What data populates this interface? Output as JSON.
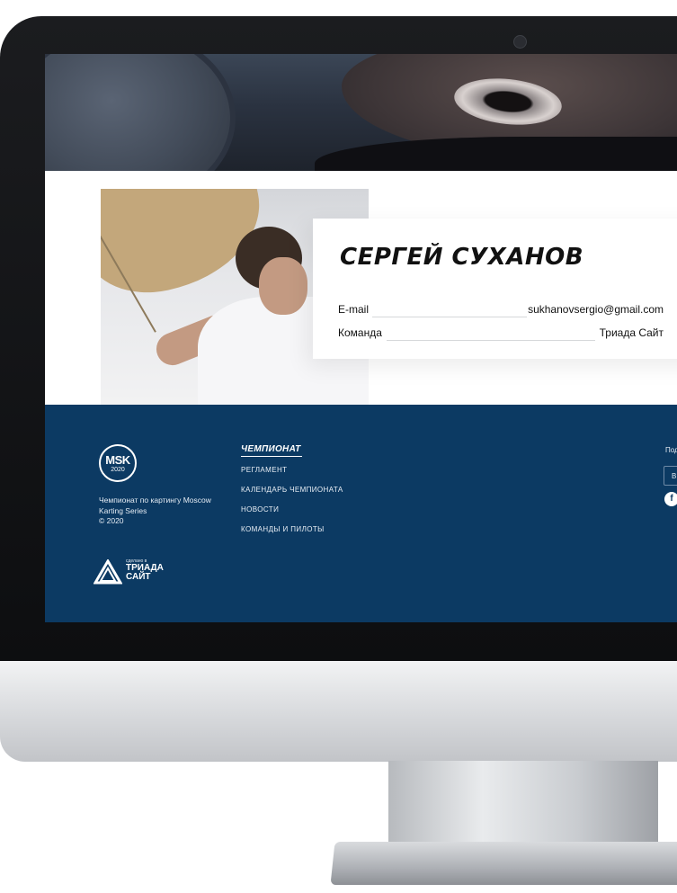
{
  "profile": {
    "name": "СЕРГЕЙ СУХАНОВ",
    "email_label": "E-mail",
    "email_value": "sukhanovsergio@gmail.com",
    "team_label": "Команда",
    "team_value": "Триада Сайт"
  },
  "footer": {
    "logo_text": "MSK",
    "logo_year": "2020",
    "description": "Чемпионат по картингу Moscow Karting Series",
    "copyright": "© 2020",
    "nav_title": "ЧЕМПИОНАТ",
    "nav_items": [
      "РЕГЛАМЕНТ",
      "КАЛЕНДАРЬ ЧЕМПИОНАТА",
      "НОВОСТИ",
      "КОМАНДЫ И ПИЛОТЫ"
    ],
    "subscribe_label": "Под",
    "subscribe_placeholder": "В",
    "developer_small": "сделано в",
    "developer_name_line1": "ТРИАДА",
    "developer_name_line2": "САЙТ"
  },
  "colors": {
    "footer_bg": "#0c3a63",
    "accent_text": "#111111"
  },
  "icons": {
    "social": "facebook-icon",
    "logo": "msk-emblem-icon",
    "developer": "triada-logo-icon"
  }
}
